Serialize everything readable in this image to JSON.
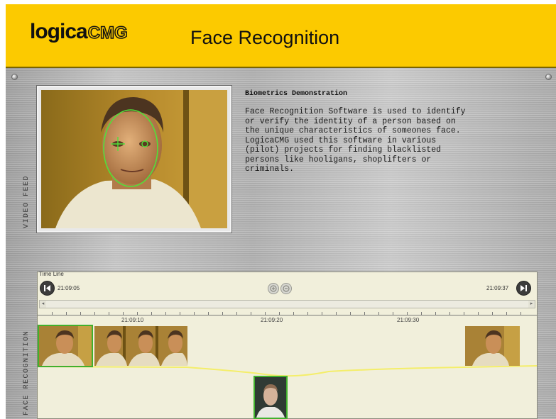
{
  "header": {
    "logo_text_1": "logica",
    "logo_text_2": "CMG",
    "title": "Face Recognition",
    "background_color": "#fcca00"
  },
  "video": {
    "side_label": "VIDEO FEED"
  },
  "description": {
    "title": "Biometrics Demonstration",
    "body": "Face Recognition Software is used to identify\nor verify the identity of a person based on\nthe unique characteristics of someones face.\nLogicaCMG used this software in various\n(pilot) projects for finding blacklisted\npersons like hooligans, shoplifters or\ncriminals."
  },
  "timeline": {
    "label": "Time Line",
    "start_time": "21:09:05",
    "end_time": "21:09:37",
    "ticks": [
      "21:09:10",
      "21:09:20",
      "21:09:30"
    ],
    "side_label": "FACE RECOGNITION",
    "prev_icon": "previous-icon",
    "next_icon": "next-icon",
    "zoom_in_icon": "zoom-in-icon",
    "zoom_out_icon": "zoom-out-icon",
    "highlight_color": "#41b02d",
    "curve_color": "#f4ee6a"
  }
}
